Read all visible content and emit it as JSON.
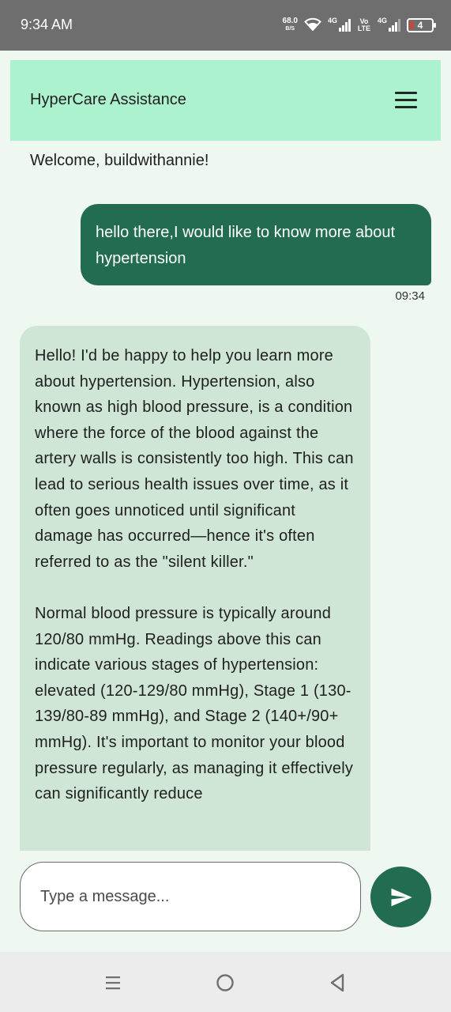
{
  "status_bar": {
    "time": "9:34 AM",
    "net_speed_value": "68.0",
    "net_speed_unit": "B/S",
    "sim1_tag": "4G",
    "volte": "Vo LTE",
    "sim2_tag": "4G",
    "battery_level": "4",
    "icons": [
      "wifi-icon",
      "signal-icon",
      "battery-icon"
    ]
  },
  "header": {
    "title": "HyperCare Assistance",
    "menu_icon": "hamburger-menu-icon",
    "background_color": "#adf2ce"
  },
  "welcome_text": "Welcome, buildwithannie!",
  "messages": [
    {
      "sender": "user",
      "text": "hello there,I would like to know more about hypertension",
      "time": "09:34",
      "bubble_color": "#226d4f"
    },
    {
      "sender": "assistant",
      "paragraphs": [
        "Hello! I'd be happy to help you learn more about hypertension. Hypertension, also known as high blood pressure, is a condition where the force of the blood against the artery walls is consistently too high. This can lead to serious health issues over time, as it often goes unnoticed until significant damage has occurred—hence it's often referred to as the \"silent killer.\"",
        "Normal blood pressure is typically around 120/80 mmHg. Readings above this can indicate various stages of hypertension: elevated (120-129/80 mmHg), Stage 1 (130-139/80-89 mmHg), and Stage 2 (140+/90+ mmHg). It's important to monitor your blood pressure regularly, as managing it effectively can significantly reduce"
      ],
      "bubble_color": "#cfe6d7"
    }
  ],
  "composer": {
    "placeholder": "Type a message...",
    "value": "",
    "send_icon": "send-icon"
  },
  "nav_bar": {
    "icons": [
      "recents-icon",
      "home-icon",
      "back-icon"
    ]
  },
  "colors": {
    "accent": "#226d4f",
    "page_background": "#eef8f1",
    "status_bar": "#6e6e6e"
  }
}
